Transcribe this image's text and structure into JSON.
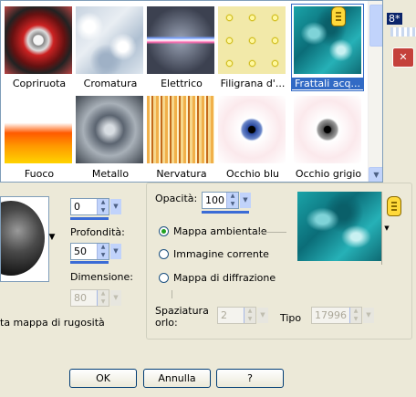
{
  "picker": {
    "row1": [
      {
        "label": "Copriruota",
        "icon": "hubcap-texture"
      },
      {
        "label": "Cromatura",
        "icon": "chrome-texture"
      },
      {
        "label": "Elettrico",
        "icon": "electric-texture"
      },
      {
        "label": "Filigrana d'...",
        "icon": "filigree-texture"
      },
      {
        "label": "Frattali acq...",
        "icon": "fractal-water-texture",
        "selected": true
      }
    ],
    "row2": [
      {
        "label": "Fuoco",
        "icon": "fire-texture"
      },
      {
        "label": "Metallo",
        "icon": "metal-texture"
      },
      {
        "label": "Nervatura",
        "icon": "veining-texture"
      },
      {
        "label": "Occhio blu",
        "icon": "blue-eye-texture"
      },
      {
        "label": "Occhio grigio",
        "icon": "gray-eye-texture"
      }
    ]
  },
  "left": {
    "top_value": "0",
    "depth_label": "Profondità:",
    "depth_value": "50",
    "size_label": "Dimensione:",
    "size_value": "80",
    "bump_label": "ta mappa di rugosità"
  },
  "right": {
    "opacity_label": "Opacità:",
    "opacity_value": "100",
    "radio_ambient": "Mappa ambientale",
    "radio_current": "Immagine corrente",
    "radio_diffraction": "Mappa di diffrazione",
    "spacing_label_1": "Spaziatura",
    "spacing_label_2": "orlo:",
    "spacing_value": "2",
    "type_label": "Tipo",
    "type_value": "17996"
  },
  "buttons": {
    "ok": "OK",
    "cancel": "Annulla",
    "help": "?"
  },
  "header_fragment": "8*",
  "colors": {
    "accent": "#316ac5",
    "dialog_bg": "#ece9d8",
    "close_red": "#c4413b"
  }
}
